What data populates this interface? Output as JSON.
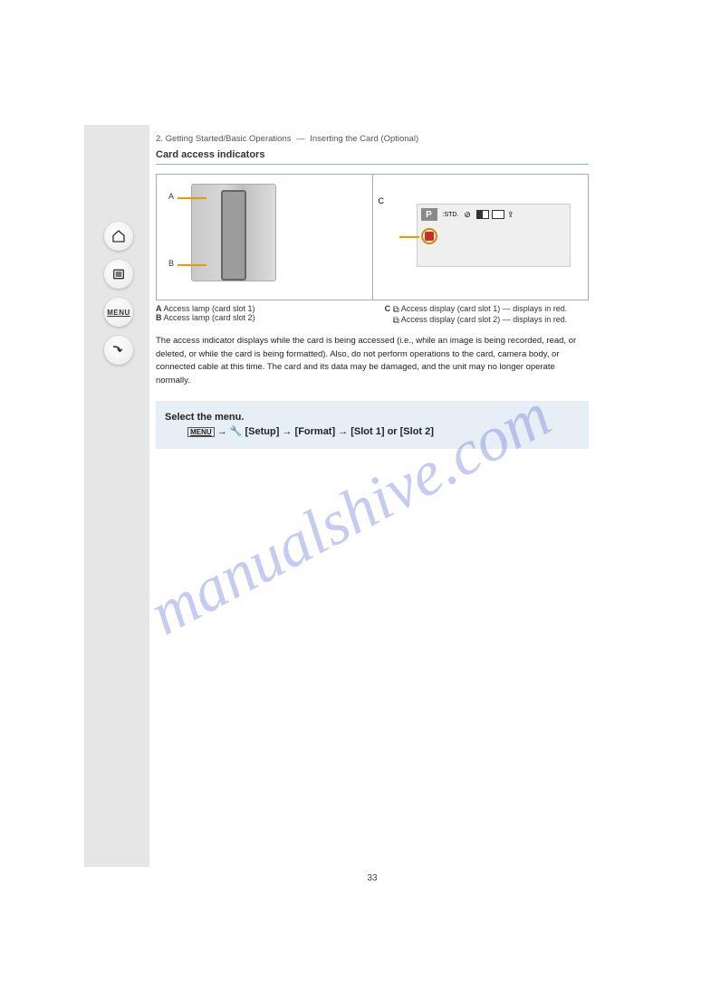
{
  "watermark": "manualshive.com",
  "nav": {
    "home_label": "home",
    "list_label": "list",
    "menu_label": "MENU",
    "back_label": "back"
  },
  "breadcrumb": {
    "part1": "2.",
    "part2": "Getting Started/Basic Operations",
    "part3": "Inserting the Card (Optional)"
  },
  "section_title": "Card access indicators",
  "figure": {
    "slotA": "A",
    "slotB": "B",
    "recC": "C",
    "p_badge": "P",
    "std": ":STD.",
    "caption_left_a": "A",
    "caption_left_a_txt": "Access lamp (card slot 1)",
    "caption_left_b": "B",
    "caption_left_b_txt": "Access lamp (card slot 2)",
    "caption_right_c": "C",
    "caption_right_txt": "Access display (card slot 1) — displays in red.",
    "caption_right_txt2": "Access display (card slot 2) — displays in red."
  },
  "paragraph": "The access indicator displays while the card is being accessed (i.e., while an image is being recorded, read, or deleted, or while the card is being formatted). Also, do not perform operations to the card, camera body, or connected cable at this time. The card and its data may be damaged, and the unit may no longer operate normally.",
  "step": {
    "line1": "Select the menu.",
    "line2_prefix": "",
    "line2_menu": "MENU",
    "line2_arrow": " → ",
    "line2_cat": "[Setup]",
    "line2_item": " → [Format] → [Slot 1] or [Slot 2]"
  },
  "page_number": "33"
}
